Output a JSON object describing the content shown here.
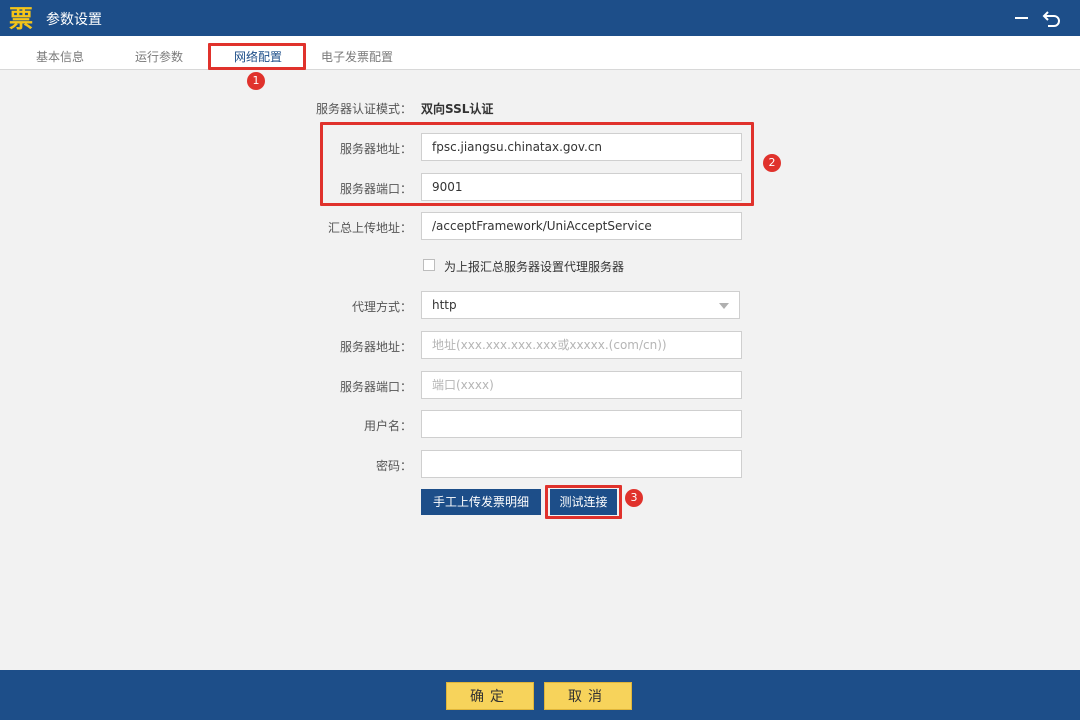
{
  "window": {
    "logo_glyph": "票",
    "title": "参数设置",
    "minimize_icon": "minimize-icon",
    "back_icon": "undo-arrow-icon"
  },
  "tabs": [
    {
      "label": "基本信息",
      "active": false
    },
    {
      "label": "运行参数",
      "active": false
    },
    {
      "label": "网络配置",
      "active": true
    },
    {
      "label": "电子发票配置",
      "active": false
    }
  ],
  "annotations": [
    "1",
    "2",
    "3"
  ],
  "form": {
    "auth_mode": {
      "label": "服务器认证模式：",
      "value": "双向SSL认证"
    },
    "server_address": {
      "label": "服务器地址：",
      "value": "fpsc.jiangsu.chinatax.gov.cn"
    },
    "server_port": {
      "label": "服务器端口：",
      "value": "9001"
    },
    "upload_address": {
      "label": "汇总上传地址：",
      "value": "/acceptFramework/UniAcceptService"
    },
    "proxy_checkbox": {
      "label": "为上报汇总服务器设置代理服务器",
      "checked": false
    },
    "proxy_method": {
      "label": "代理方式：",
      "value": "http"
    },
    "proxy_address": {
      "label": "服务器地址：",
      "placeholder": "地址(xxx.xxx.xxx.xxx或xxxxx.(com/cn))"
    },
    "proxy_port": {
      "label": "服务器端口：",
      "placeholder": "端口(xxxx)"
    },
    "username": {
      "label": "用户名：",
      "value": ""
    },
    "password": {
      "label": "密码：",
      "value": ""
    },
    "upload_button": "手工上传发票明细",
    "test_button": "测试连接"
  },
  "footer": {
    "ok": "确定",
    "cancel": "取消"
  },
  "colors": {
    "primary": "#1d4e89",
    "accent_yellow": "#f7d35b",
    "annotation_red": "#e0322c",
    "logo_gold": "#f5c518"
  }
}
